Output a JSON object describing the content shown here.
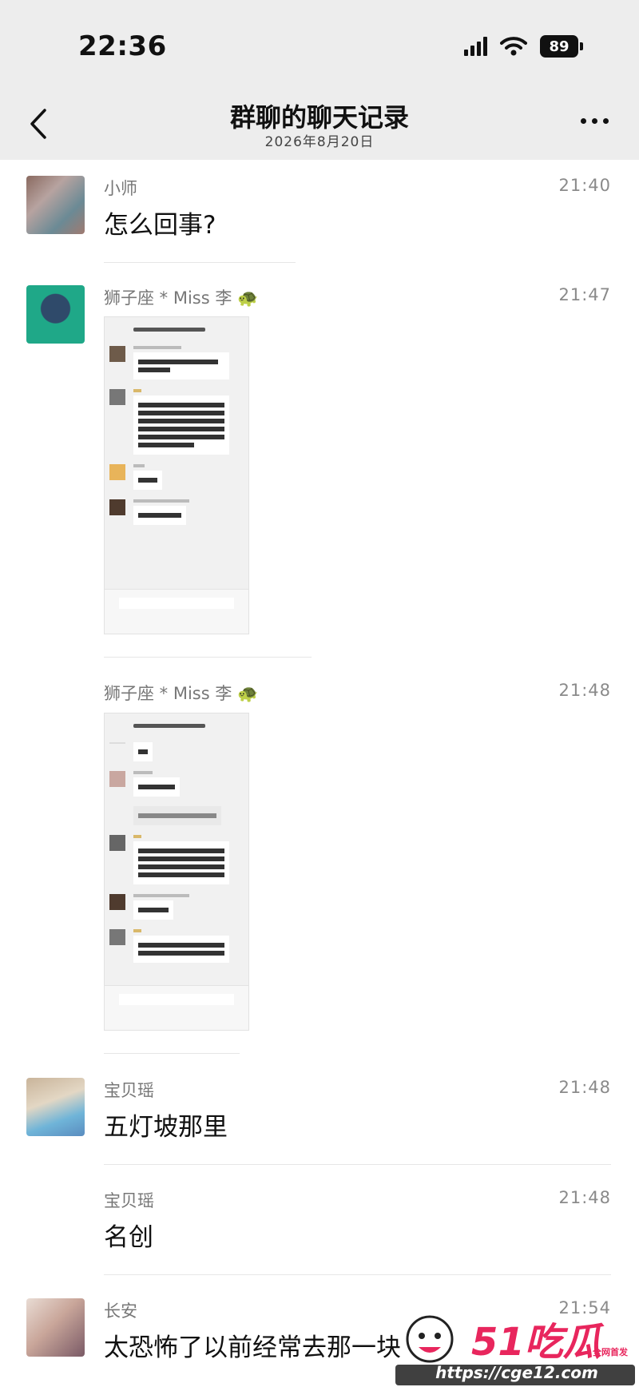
{
  "status_bar": {
    "time": "22:36",
    "battery": "89"
  },
  "nav": {
    "title": "群聊的聊天记录",
    "subtitle": "2026年8月20日"
  },
  "messages": [
    {
      "sender": "小师",
      "time": "21:40",
      "text": "怎么回事?"
    },
    {
      "sender": "狮子座 * Miss 李",
      "time": "21:47",
      "text": "",
      "attachment": "screenshot",
      "badge_icon": "turtle-icon"
    },
    {
      "sender": "狮子座 * Miss 李",
      "time": "21:48",
      "text": "",
      "attachment": "screenshot",
      "badge_icon": "turtle-icon"
    },
    {
      "sender": "宝贝瑶",
      "time": "21:48",
      "text": "五灯坡那里"
    },
    {
      "sender": "宝贝瑶",
      "time": "21:48",
      "text": "名创"
    },
    {
      "sender": "长安",
      "time": "21:54",
      "text": "太恐怖了以前经常去那一块"
    }
  ],
  "watermark": {
    "brand": "51吃瓜",
    "url": "https://cge12.com",
    "tagline": "全网首发"
  },
  "colors": {
    "header_bg": "#ededed",
    "text": "#111111",
    "meta": "#8a8a8a",
    "watermark": "#e8265d"
  }
}
